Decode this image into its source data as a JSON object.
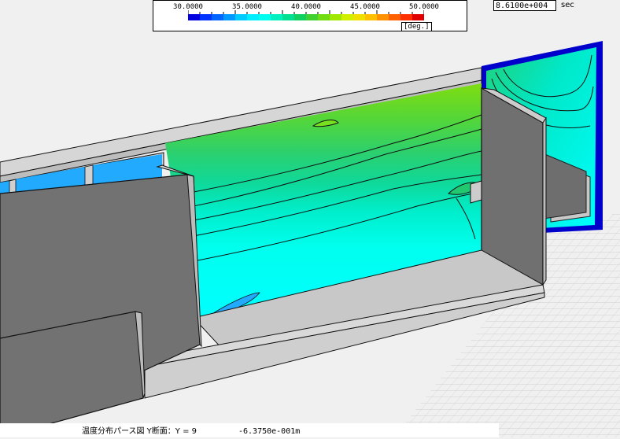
{
  "colorbar": {
    "labels": [
      "30.0000",
      "35.0000",
      "40.0000",
      "45.0000",
      "50.0000"
    ],
    "unit": "[deg.]",
    "colors": [
      "#0000e0",
      "#0033ff",
      "#0066ff",
      "#0099ff",
      "#00ccff",
      "#00eeff",
      "#00ffee",
      "#00f0c0",
      "#00e090",
      "#10d060",
      "#40d030",
      "#70dd10",
      "#a0e800",
      "#d0f000",
      "#f0e000",
      "#ffc000",
      "#ff9000",
      "#ff6000",
      "#ff3000",
      "#e00000"
    ]
  },
  "time": {
    "value": "8.6100e+004",
    "unit": "sec"
  },
  "status": {
    "text": "温度分布パース図 Y断面：Y = 9",
    "coord": "-6.3750e-001m"
  }
}
